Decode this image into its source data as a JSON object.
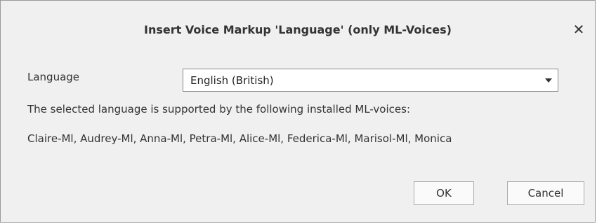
{
  "dialog": {
    "title": "Insert Voice Markup 'Language' (only ML-Voices)",
    "close_icon": "close-icon",
    "language_label": "Language",
    "language_selected": "English (British)",
    "dropdown_icon": "chevron-down-icon",
    "info_text": "The selected language is supported by the following installed ML-voices:",
    "voices": "Claire-Ml, Audrey-Ml, Anna-Ml, Petra-Ml, Alice-Ml, Federica-Ml, Marisol-Ml, Monica",
    "ok_label": "OK",
    "cancel_label": "Cancel"
  }
}
